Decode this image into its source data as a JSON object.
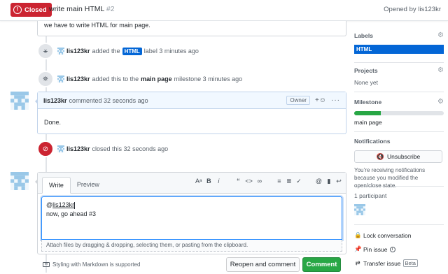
{
  "header": {
    "state": "Closed",
    "title": "write main HTML",
    "number": "#2",
    "opened_by": "Opened by lis123kr"
  },
  "first_comment": {
    "body": "we have to write HTML for main page."
  },
  "events": {
    "label": {
      "user": "lis123kr",
      "pre": "added the",
      "label": "HTML",
      "post": "label 3 minutes ago"
    },
    "milestone": {
      "user": "lis123kr",
      "pre": "added this to the",
      "milestone": "main page",
      "post": "milestone 3 minutes ago"
    },
    "closed": {
      "user": "lis123kr",
      "text": "closed this 32 seconds ago"
    }
  },
  "comment": {
    "user": "lis123kr",
    "meta": "commented 32 seconds ago",
    "role": "Owner",
    "body": "Done."
  },
  "new_comment": {
    "tab_write": "Write",
    "tab_preview": "Preview",
    "line1_mention": "lis123kr",
    "line2": "now, go ahead #3",
    "attach_hint": "Attach files by dragging & dropping, selecting them, or pasting from the clipboard.",
    "markdown_note": "Styling with Markdown is supported",
    "reopen_label": "Reopen and comment",
    "comment_label": "Comment"
  },
  "sidebar": {
    "labels_title": "Labels",
    "label": "HTML",
    "projects_title": "Projects",
    "projects_value": "None yet",
    "milestone_title": "Milestone",
    "milestone_progress": 0.3,
    "milestone_name": "main page",
    "notifications_title": "Notifications",
    "unsubscribe_label": "Unsubscribe",
    "notifications_note": "You’re receiving notifications because you modified the open/close state.",
    "participants": "1 participant",
    "lock": "Lock conversation",
    "pin": "Pin issue",
    "transfer": "Transfer issue",
    "beta": "Beta"
  },
  "colors": {
    "closed": "#cb2431",
    "label_html": "#0366d6",
    "progress": "#28a745",
    "comment_btn": "#28a745"
  }
}
